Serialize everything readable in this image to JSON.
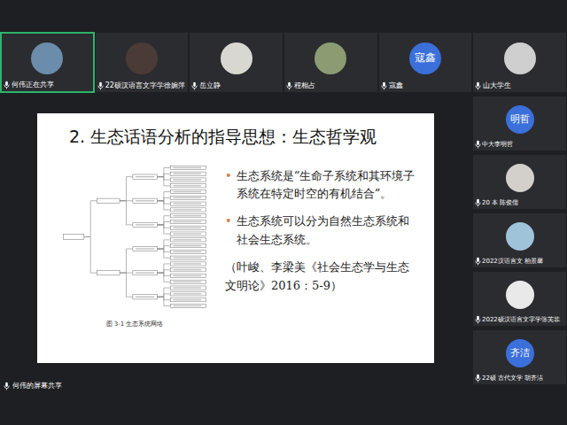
{
  "top_participants": [
    {
      "name": "何伟正在共享",
      "kind": "photo",
      "color": "#6b8cab",
      "highlighted": true
    },
    {
      "name": "22硕汉语言文字学徐婉萍",
      "kind": "photo",
      "color": "#4a3b36",
      "highlighted": false
    },
    {
      "name": "岳立静",
      "kind": "photo",
      "color": "#d9d8d0",
      "highlighted": false
    },
    {
      "name": "程相占",
      "kind": "photo",
      "color": "#8c9b72",
      "highlighted": false
    },
    {
      "name": "寇鑫",
      "kind": "initials",
      "initials": "寇鑫",
      "color": "#3b6fd9",
      "highlighted": false
    },
    {
      "name": "山大学生",
      "kind": "photo",
      "color": "#cfcfcf",
      "highlighted": false
    }
  ],
  "side_participants": [
    {
      "name": "中大李明哲",
      "kind": "initials",
      "initials": "明哲",
      "color": "#3b6fd9",
      "highlighted": false
    },
    {
      "name": "20 本 陈俊儒",
      "kind": "photo",
      "color": "#d3d0cb",
      "highlighted": false
    },
    {
      "name": "2022汉语言文 柏景馨",
      "kind": "photo",
      "color": "#9fc4da",
      "highlighted": false
    },
    {
      "name": "2022硕汉语言文字学张芙菲",
      "kind": "photo",
      "color": "#e9e9e9",
      "highlighted": false
    },
    {
      "name": "22硕 古代文学 胡齐洁",
      "kind": "initials",
      "initials": "齐洁",
      "color": "#3b6fd9",
      "highlighted": false
    }
  ],
  "share_label": "何伟的屏幕共享",
  "slide": {
    "title": "2. 生态话语分析的指导思想：生态哲学观",
    "bullet_mark": "•",
    "bullets": [
      "生态系统是“生命子系统和其环境子系统在特定时空的有机结合”。",
      "生态系统可以分为自然生态系统和社会生态系统。"
    ],
    "citation": "（叶峻、李梁美《社会生态学与生态文明论》2016：5-9）",
    "figure_caption": "图 3-1 生态系统网络"
  }
}
